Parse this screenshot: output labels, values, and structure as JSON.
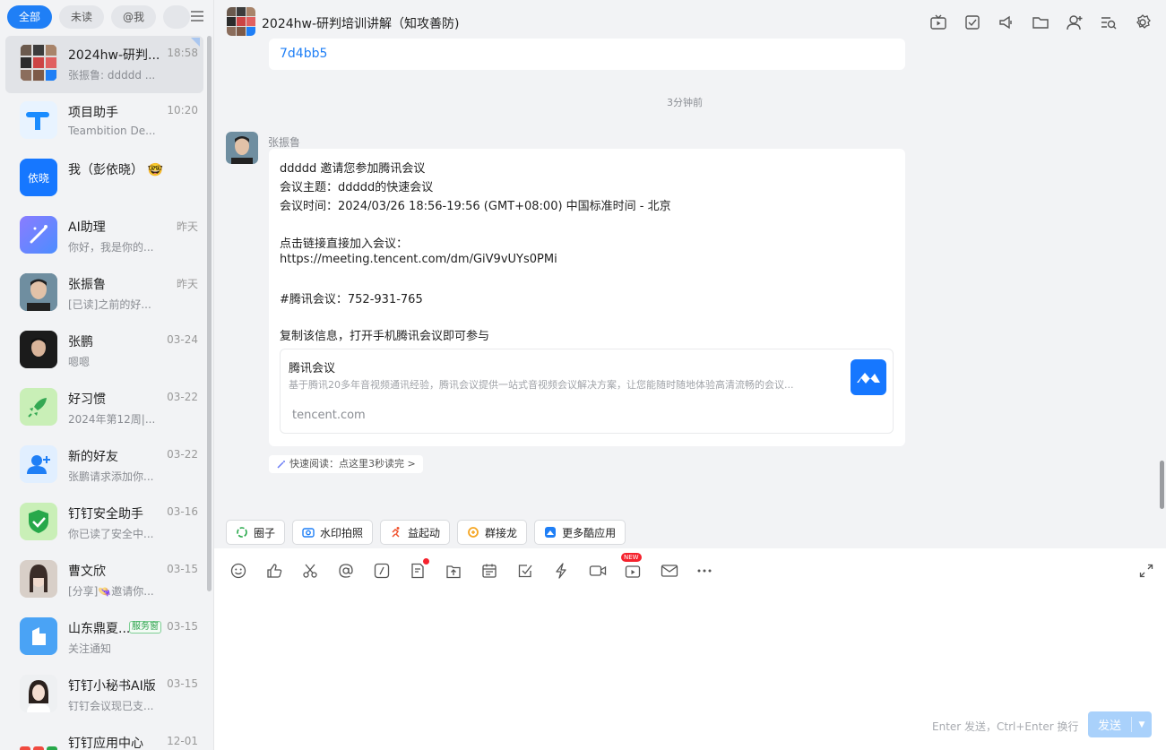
{
  "filters": [
    "全部",
    "未读",
    "@我"
  ],
  "conversations": [
    {
      "name": "2024hw-研判...",
      "preview": "张振鲁: ddddd ...",
      "time": "18:58",
      "active": true
    },
    {
      "name": "项目助手",
      "preview": "Teambition De...",
      "time": "10:20"
    },
    {
      "name": "我（彭依晓）",
      "preview": "",
      "time": "",
      "avatar_text": "依晓"
    },
    {
      "name": "AI助理",
      "preview": "你好，我是你的...",
      "time": "昨天"
    },
    {
      "name": "张振鲁",
      "preview": "[已读]之前的好...",
      "time": "昨天"
    },
    {
      "name": "张鹏",
      "preview": "嗯嗯",
      "time": "03-24"
    },
    {
      "name": "好习惯",
      "preview": "2024年第12周|...",
      "time": "03-22"
    },
    {
      "name": "新的好友",
      "preview": "张鹏请求添加你...",
      "time": "03-22"
    },
    {
      "name": "钉钉安全助手",
      "preview": "你已读了安全中...",
      "time": "03-16"
    },
    {
      "name": "曹文欣",
      "preview": "[分享]👒邀请你...",
      "time": "03-15"
    },
    {
      "name": "山东鼎夏...",
      "preview": "关注通知",
      "time": "03-15",
      "badge": "服务窗"
    },
    {
      "name": "钉钉小秘书AI版",
      "preview": "钉钉会议现已支...",
      "time": "03-15"
    },
    {
      "name": "钉钉应用中心",
      "preview": "",
      "time": "12-01"
    }
  ],
  "chat": {
    "title": "2024hw-研判培训讲解（知攻善防)",
    "prev_msg_tail": "7d4bb5",
    "time_separator": "3分钟前",
    "sender": "张振鲁",
    "lines": [
      "ddddd 邀请您参加腾讯会议",
      "会议主题：ddddd的快速会议",
      "会议时间：2024/03/26 18:56-19:56 (GMT+08:00) 中国标准时间 - 北京",
      "点击链接直接加入会议：",
      "https://meeting.tencent.com/dm/GiV9vUYs0PMi",
      "#腾讯会议：752-931-765",
      "复制该信息，打开手机腾讯会议即可参与"
    ],
    "card": {
      "title": "腾讯会议",
      "desc": "基于腾讯20多年音视频通讯经验，腾讯会议提供一站式音视频会议解决方案，让您能随时随地体验高清流畅的会议...",
      "url": "tencent.com"
    },
    "quick_read": "快速阅读：点这里3秒读完 >"
  },
  "apps": [
    "圈子",
    "水印拍照",
    "益起动",
    "群接龙",
    "更多酷应用"
  ],
  "toolbar_icons": [
    "emoji-icon",
    "thumb-up-icon",
    "scissors-icon",
    "at-icon",
    "slash-icon",
    "doc-add-icon",
    "upload-icon",
    "calendar-icon",
    "check-icon",
    "lightning-icon",
    "video-icon",
    "live-icon",
    "mail-icon",
    "more-icon"
  ],
  "new_badge": "NEW",
  "input": {
    "hint": "Enter 发送，Ctrl+Enter 换行",
    "send": "发送"
  }
}
